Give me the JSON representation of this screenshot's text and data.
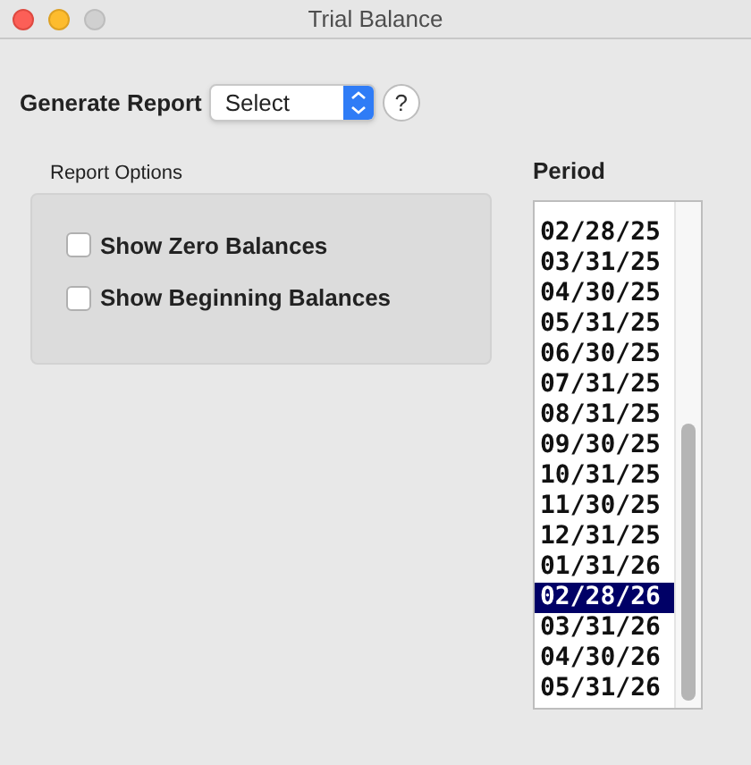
{
  "window": {
    "title": "Trial Balance"
  },
  "generate_report": {
    "label": "Generate Report",
    "value": "Select",
    "help": "?"
  },
  "report_options": {
    "title": "Report Options",
    "options": [
      {
        "label": "Show Zero Balances",
        "checked": false
      },
      {
        "label": "Show Beginning Balances",
        "checked": false
      }
    ]
  },
  "period": {
    "label": "Period",
    "items": [
      {
        "label": "02/28/25",
        "selected": false
      },
      {
        "label": "03/31/25",
        "selected": false
      },
      {
        "label": "04/30/25",
        "selected": false
      },
      {
        "label": "05/31/25",
        "selected": false
      },
      {
        "label": "06/30/25",
        "selected": false
      },
      {
        "label": "07/31/25",
        "selected": false
      },
      {
        "label": "08/31/25",
        "selected": false
      },
      {
        "label": "09/30/25",
        "selected": false
      },
      {
        "label": "10/31/25",
        "selected": false
      },
      {
        "label": "11/30/25",
        "selected": false
      },
      {
        "label": "12/31/25",
        "selected": false
      },
      {
        "label": "01/31/26",
        "selected": false
      },
      {
        "label": "02/28/26",
        "selected": true
      },
      {
        "label": "03/31/26",
        "selected": false
      },
      {
        "label": "04/30/26",
        "selected": false
      },
      {
        "label": "05/31/26",
        "selected": false
      }
    ]
  }
}
